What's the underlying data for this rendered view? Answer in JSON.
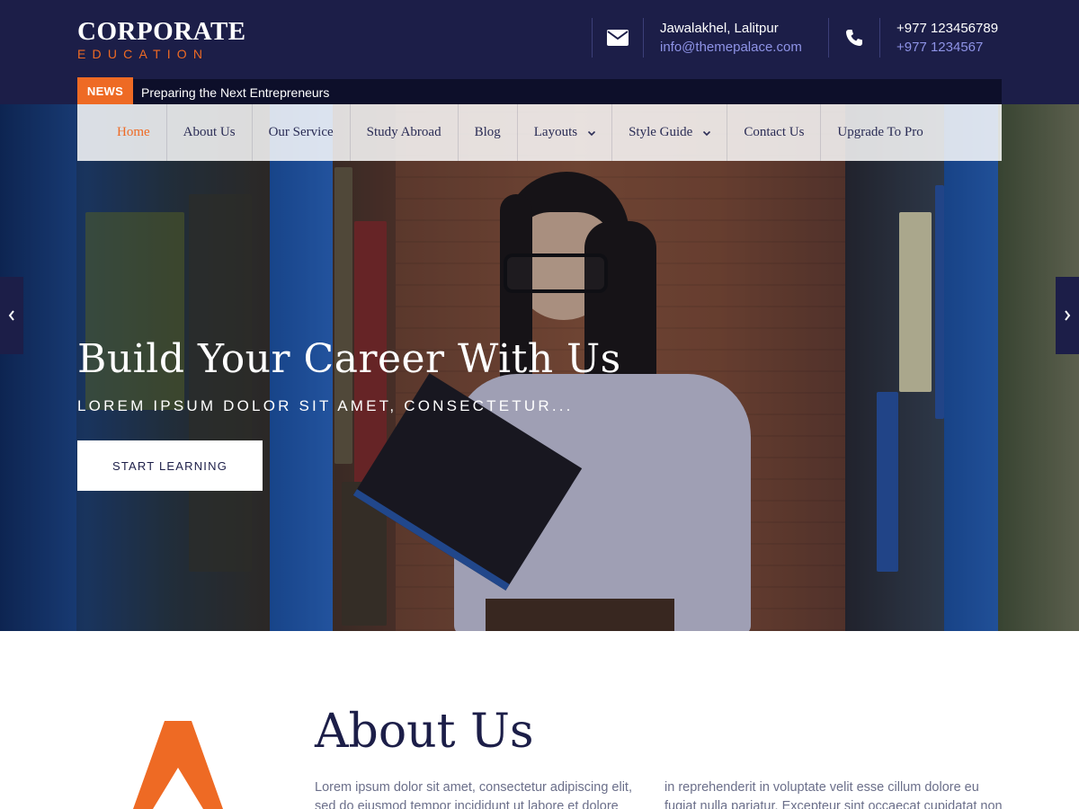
{
  "brand": {
    "title": "CORPORATE",
    "subtitle": "EDUCATION",
    "accent_color": "#ee6a24",
    "primary_color": "#1c1e48"
  },
  "header": {
    "address": {
      "icon": "envelope-icon",
      "line1": "Jawalakhel, Lalitpur",
      "line2": "info@themepalace.com"
    },
    "phone": {
      "icon": "phone-icon",
      "line1": "+977 123456789",
      "line2": "+977 1234567"
    }
  },
  "news": {
    "label": "NEWS",
    "headline": "Preparing the Next Entrepreneurs"
  },
  "nav": {
    "items": [
      {
        "label": "Home",
        "active": true
      },
      {
        "label": "About Us"
      },
      {
        "label": "Our Service"
      },
      {
        "label": "Study Abroad"
      },
      {
        "label": "Blog"
      },
      {
        "label": "Layouts",
        "dropdown": true
      },
      {
        "label": "Style Guide",
        "dropdown": true
      },
      {
        "label": "Contact Us"
      },
      {
        "label": "Upgrade To Pro"
      }
    ]
  },
  "hero": {
    "title": "Build Your Career With Us",
    "subtitle": "LOREM IPSUM DOLOR SIT AMET, CONSECTETUR...",
    "button": "START LEARNING",
    "prev_icon": "chevron-left-icon",
    "next_icon": "chevron-right-icon"
  },
  "about": {
    "title": "About Us",
    "col1": "Lorem ipsum dolor sit amet, consectetur adipiscing elit, sed do eiusmod tempor incididunt ut labore et dolore magna",
    "col2": "in reprehenderit in voluptate velit esse cillum dolore eu fugiat nulla pariatur. Excepteur sint occaecat cupidatat non"
  }
}
